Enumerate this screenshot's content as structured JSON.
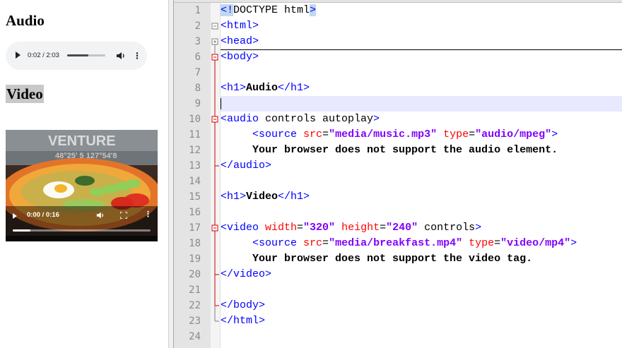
{
  "preview": {
    "audio_heading": "Audio",
    "video_heading": "Video",
    "audio_player": {
      "time": "0:02 / 2:03",
      "progress_fraction": 0.55,
      "play_icon": "play-icon",
      "volume_icon": "volume-icon",
      "menu_icon": "more-vert-icon"
    },
    "video_player": {
      "time": "0:00 / 0:16",
      "progress_fraction": 0.13,
      "play_icon": "play-icon",
      "volume_icon": "volume-icon",
      "fullscreen_icon": "fullscreen-icon",
      "menu_icon": "more-vert-icon"
    }
  },
  "editor": {
    "line_numbers": [
      "1",
      "2",
      "3",
      "6",
      "7",
      "8",
      "9",
      "10",
      "11",
      "12",
      "13",
      "14",
      "15",
      "16",
      "17",
      "18",
      "19",
      "20",
      "21",
      "22",
      "23",
      "24"
    ],
    "current_line": "9",
    "lines": [
      {
        "n": "1",
        "tokens": [
          {
            "t": "<!",
            "c": "t-doctype"
          },
          {
            "t": "DOCTYPE html",
            "c": "t-plain"
          },
          {
            "t": ">",
            "c": "t-doctype"
          }
        ]
      },
      {
        "n": "2",
        "tokens": [
          {
            "t": "<html>",
            "c": "t-tag"
          }
        ]
      },
      {
        "n": "3",
        "tokens": [
          {
            "t": "<head>",
            "c": "t-tag"
          }
        ]
      },
      {
        "n": "6",
        "tokens": [
          {
            "t": "<body>",
            "c": "t-tag"
          }
        ]
      },
      {
        "n": "7",
        "tokens": []
      },
      {
        "n": "8",
        "tokens": [
          {
            "t": "<h1>",
            "c": "t-tag"
          },
          {
            "t": "Audio",
            "c": "t-text"
          },
          {
            "t": "</h1>",
            "c": "t-tag"
          }
        ]
      },
      {
        "n": "9",
        "tokens": []
      },
      {
        "n": "10",
        "tokens": [
          {
            "t": "<audio ",
            "c": "t-tag"
          },
          {
            "t": "controls autoplay",
            "c": "t-plain"
          },
          {
            "t": ">",
            "c": "t-tag"
          }
        ]
      },
      {
        "n": "11",
        "tokens": [
          {
            "t": "     <source ",
            "c": "t-tag"
          },
          {
            "t": "src",
            "c": "t-attr"
          },
          {
            "t": "=",
            "c": "t-plain"
          },
          {
            "t": "\"media/music.mp3\"",
            "c": "t-val"
          },
          {
            "t": " type",
            "c": "t-attr"
          },
          {
            "t": "=",
            "c": "t-plain"
          },
          {
            "t": "\"audio/mpeg\"",
            "c": "t-val"
          },
          {
            "t": ">",
            "c": "t-tag"
          }
        ]
      },
      {
        "n": "12",
        "tokens": [
          {
            "t": "     Your browser does not support the audio element.",
            "c": "t-text"
          }
        ]
      },
      {
        "n": "13",
        "tokens": [
          {
            "t": "</audio>",
            "c": "t-tag"
          }
        ]
      },
      {
        "n": "14",
        "tokens": []
      },
      {
        "n": "15",
        "tokens": [
          {
            "t": "<h1>",
            "c": "t-tag"
          },
          {
            "t": "Video",
            "c": "t-text"
          },
          {
            "t": "</h1>",
            "c": "t-tag"
          }
        ]
      },
      {
        "n": "16",
        "tokens": []
      },
      {
        "n": "17",
        "tokens": [
          {
            "t": "<video ",
            "c": "t-tag"
          },
          {
            "t": "width",
            "c": "t-attr"
          },
          {
            "t": "=",
            "c": "t-plain"
          },
          {
            "t": "\"320\"",
            "c": "t-val"
          },
          {
            "t": " height",
            "c": "t-attr"
          },
          {
            "t": "=",
            "c": "t-plain"
          },
          {
            "t": "\"240\"",
            "c": "t-val"
          },
          {
            "t": " controls",
            "c": "t-plain"
          },
          {
            "t": ">",
            "c": "t-tag"
          }
        ]
      },
      {
        "n": "18",
        "tokens": [
          {
            "t": "     <source ",
            "c": "t-tag"
          },
          {
            "t": "src",
            "c": "t-attr"
          },
          {
            "t": "=",
            "c": "t-plain"
          },
          {
            "t": "\"media/breakfast.mp4\"",
            "c": "t-val"
          },
          {
            "t": " type",
            "c": "t-attr"
          },
          {
            "t": "=",
            "c": "t-plain"
          },
          {
            "t": "\"video/mp4\"",
            "c": "t-val"
          },
          {
            "t": ">",
            "c": "t-tag"
          }
        ]
      },
      {
        "n": "19",
        "tokens": [
          {
            "t": "     Your browser does not support the video tag.",
            "c": "t-text"
          }
        ]
      },
      {
        "n": "20",
        "tokens": [
          {
            "t": "</video>",
            "c": "t-tag"
          }
        ]
      },
      {
        "n": "21",
        "tokens": []
      },
      {
        "n": "22",
        "tokens": [
          {
            "t": "</body>",
            "c": "t-tag"
          }
        ]
      },
      {
        "n": "23",
        "tokens": [
          {
            "t": "</html>",
            "c": "t-tag"
          }
        ]
      },
      {
        "n": "24",
        "tokens": []
      }
    ]
  },
  "colors": {
    "tag": "#0000ff",
    "attribute": "#ff0000",
    "value": "#8000ff",
    "current_line_bg": "#e8e8ff",
    "fold_marker": "#d00000"
  }
}
